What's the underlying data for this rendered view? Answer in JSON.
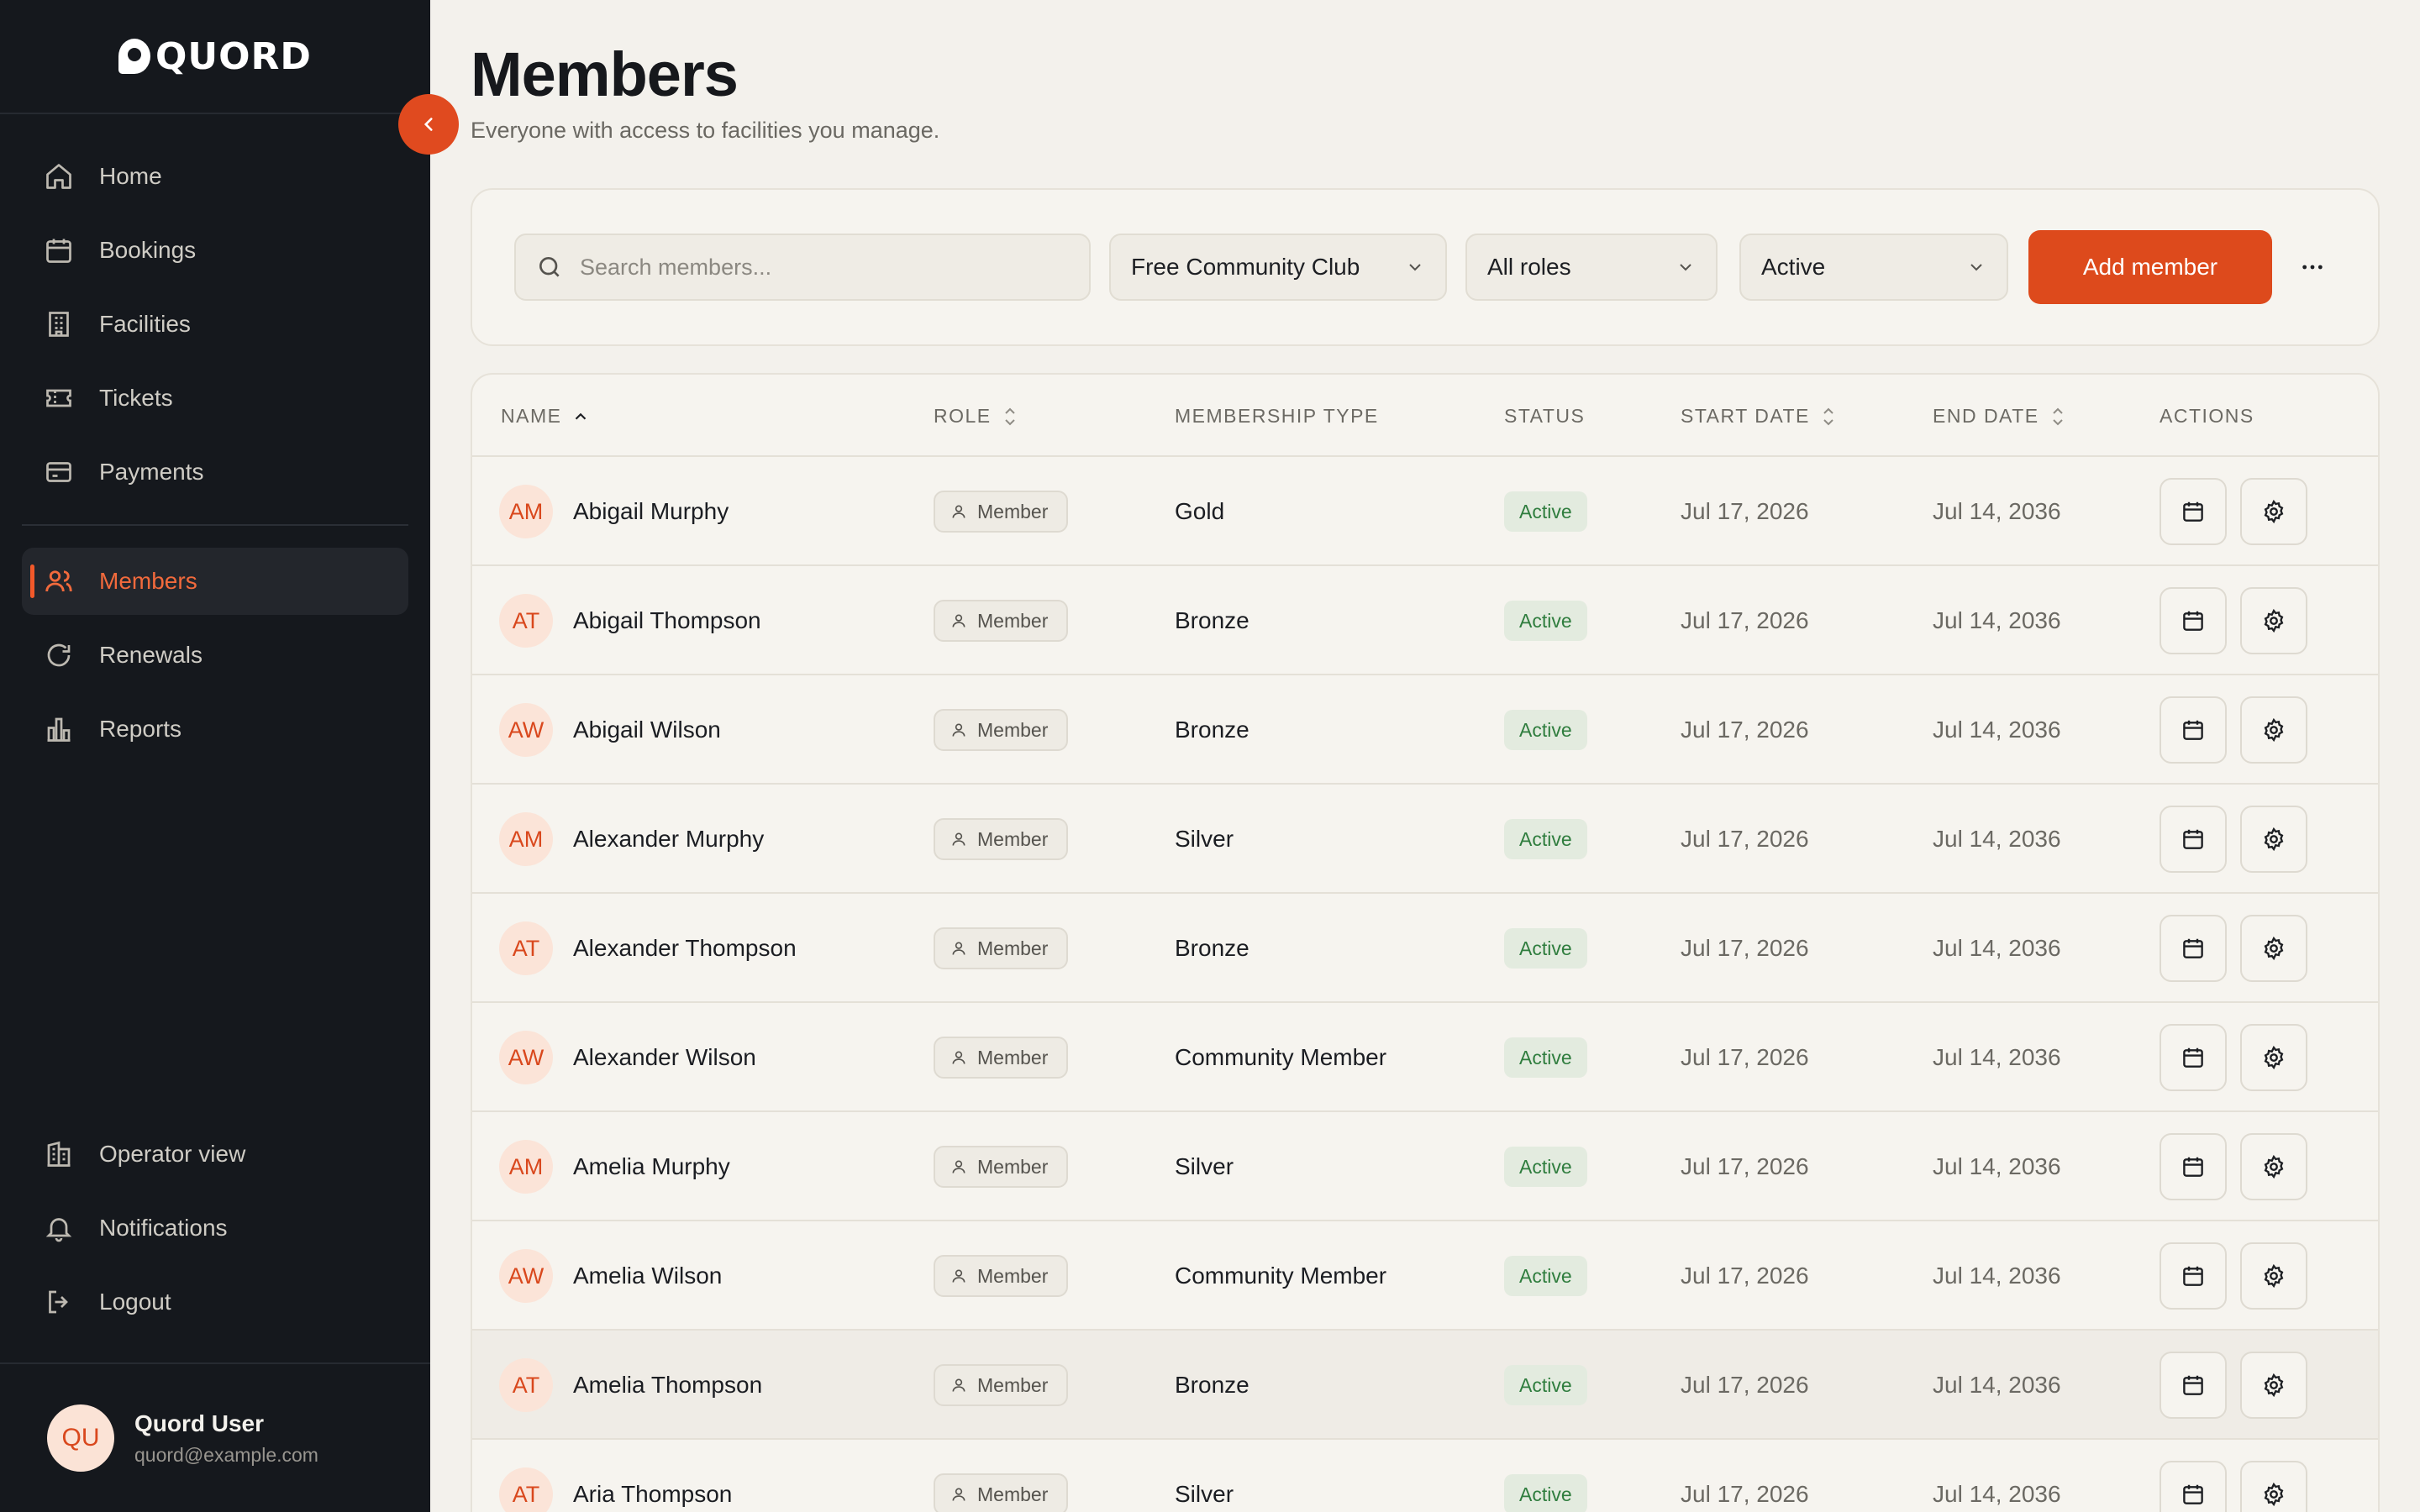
{
  "app": {
    "brand": "QUORD"
  },
  "sidebar": {
    "items": [
      {
        "label": "Home",
        "icon": "home-icon"
      },
      {
        "label": "Bookings",
        "icon": "calendar-icon"
      },
      {
        "label": "Facilities",
        "icon": "building-icon"
      },
      {
        "label": "Tickets",
        "icon": "ticket-icon"
      },
      {
        "label": "Payments",
        "icon": "credit-card-icon"
      },
      {
        "label": "Members",
        "icon": "users-icon",
        "active": true
      },
      {
        "label": "Renewals",
        "icon": "refresh-icon"
      },
      {
        "label": "Reports",
        "icon": "bar-chart-icon"
      }
    ],
    "bottom_items": [
      {
        "label": "Operator view",
        "icon": "office-building-icon"
      },
      {
        "label": "Notifications",
        "icon": "bell-icon"
      },
      {
        "label": "Logout",
        "icon": "logout-icon"
      }
    ],
    "user": {
      "initials": "QU",
      "name": "Quord User",
      "email": "quord@example.com"
    }
  },
  "header": {
    "title": "Members",
    "subtitle": "Everyone with access to facilities you manage."
  },
  "filters": {
    "search_placeholder": "Search members...",
    "club": "Free Community Club",
    "role": "All roles",
    "status": "Active",
    "add_label": "Add member"
  },
  "table": {
    "columns": [
      "NAME",
      "ROLE",
      "MEMBERSHIP TYPE",
      "STATUS",
      "START DATE",
      "END DATE",
      "ACTIONS"
    ],
    "rows": [
      {
        "initials": "AM",
        "name": "Abigail Murphy",
        "role": "Member",
        "type": "Gold",
        "status": "Active",
        "start": "Jul 17, 2026",
        "end": "Jul 14, 2036"
      },
      {
        "initials": "AT",
        "name": "Abigail Thompson",
        "role": "Member",
        "type": "Bronze",
        "status": "Active",
        "start": "Jul 17, 2026",
        "end": "Jul 14, 2036"
      },
      {
        "initials": "AW",
        "name": "Abigail Wilson",
        "role": "Member",
        "type": "Bronze",
        "status": "Active",
        "start": "Jul 17, 2026",
        "end": "Jul 14, 2036"
      },
      {
        "initials": "AM",
        "name": "Alexander Murphy",
        "role": "Member",
        "type": "Silver",
        "status": "Active",
        "start": "Jul 17, 2026",
        "end": "Jul 14, 2036"
      },
      {
        "initials": "AT",
        "name": "Alexander Thompson",
        "role": "Member",
        "type": "Bronze",
        "status": "Active",
        "start": "Jul 17, 2026",
        "end": "Jul 14, 2036"
      },
      {
        "initials": "AW",
        "name": "Alexander Wilson",
        "role": "Member",
        "type": "Community Member",
        "status": "Active",
        "start": "Jul 17, 2026",
        "end": "Jul 14, 2036"
      },
      {
        "initials": "AM",
        "name": "Amelia Murphy",
        "role": "Member",
        "type": "Silver",
        "status": "Active",
        "start": "Jul 17, 2026",
        "end": "Jul 14, 2036"
      },
      {
        "initials": "AW",
        "name": "Amelia Wilson",
        "role": "Member",
        "type": "Community Member",
        "status": "Active",
        "start": "Jul 17, 2026",
        "end": "Jul 14, 2036"
      },
      {
        "initials": "AT",
        "name": "Amelia Thompson",
        "role": "Member",
        "type": "Bronze",
        "status": "Active",
        "start": "Jul 17, 2026",
        "end": "Jul 14, 2036",
        "highlighted": true
      },
      {
        "initials": "AT",
        "name": "Aria Thompson",
        "role": "Member",
        "type": "Silver",
        "status": "Active",
        "start": "Jul 17, 2026",
        "end": "Jul 14, 2036"
      }
    ]
  },
  "colors": {
    "accent": "#dd4a1c",
    "sidebar_bg": "#15181d",
    "page_bg": "#f3f1ec",
    "status_green": "#2f7d3e"
  }
}
